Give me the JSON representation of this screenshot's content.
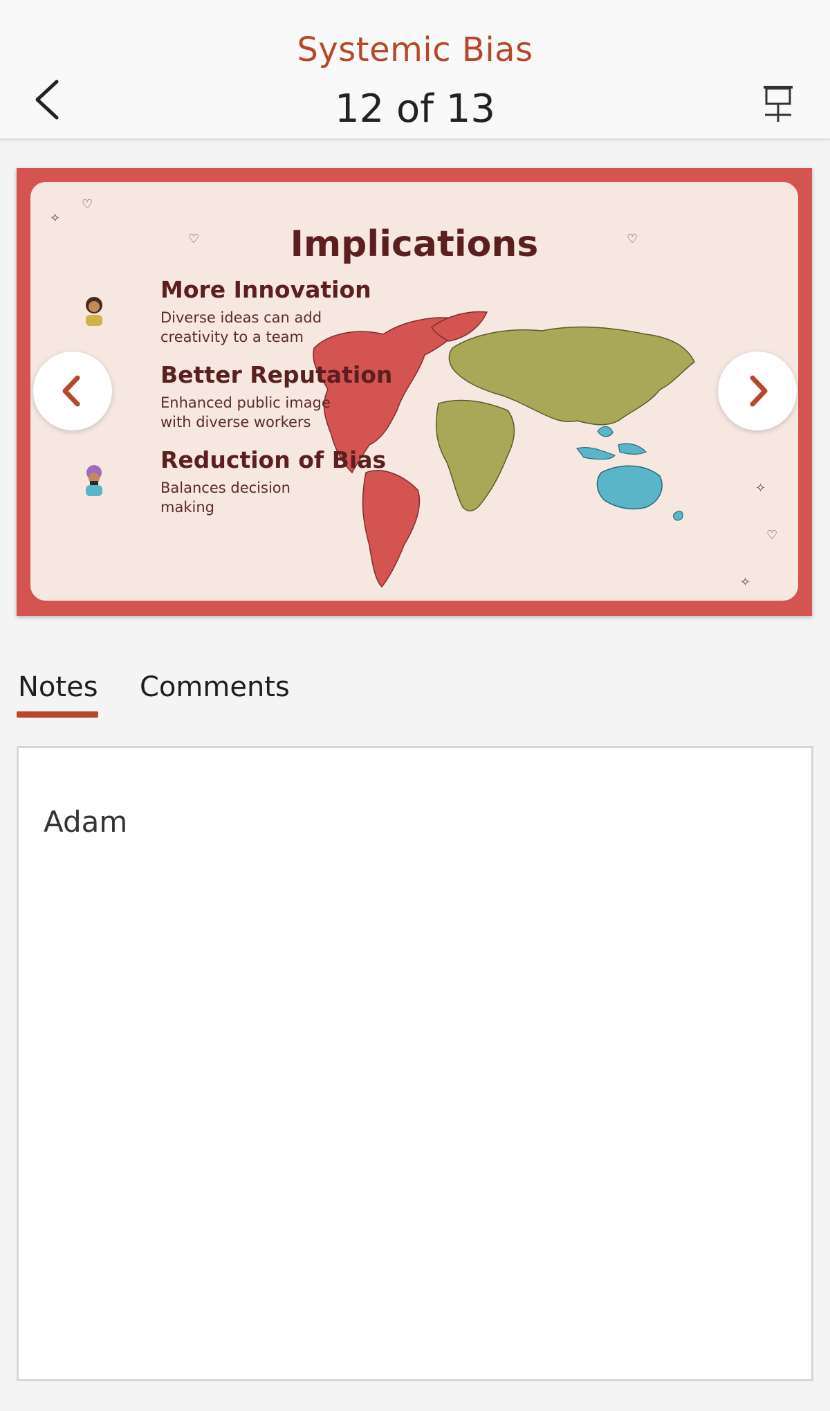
{
  "header": {
    "title": "Systemic Bias",
    "slide_counter": "12 of 13",
    "back_icon": "chevron-left-icon",
    "present_icon": "presenter-icon",
    "accent_color": "#b7472a"
  },
  "slide": {
    "title": "Implications",
    "items": [
      {
        "heading": "More Innovation",
        "desc": "Diverse ideas can add creativity to a team"
      },
      {
        "heading": "Better Reputation",
        "desc": "Enhanced public image with diverse workers"
      },
      {
        "heading": "Reduction of Bias",
        "desc": "Balances decision making"
      }
    ],
    "frame_color": "#d35450",
    "background_color": "#f6e7e1"
  },
  "nav": {
    "prev_icon": "chevron-left-icon",
    "next_icon": "chevron-right-icon"
  },
  "tabs": [
    {
      "label": "Notes",
      "active": true
    },
    {
      "label": "Comments",
      "active": false
    }
  ],
  "notes": {
    "text": "Adam"
  }
}
